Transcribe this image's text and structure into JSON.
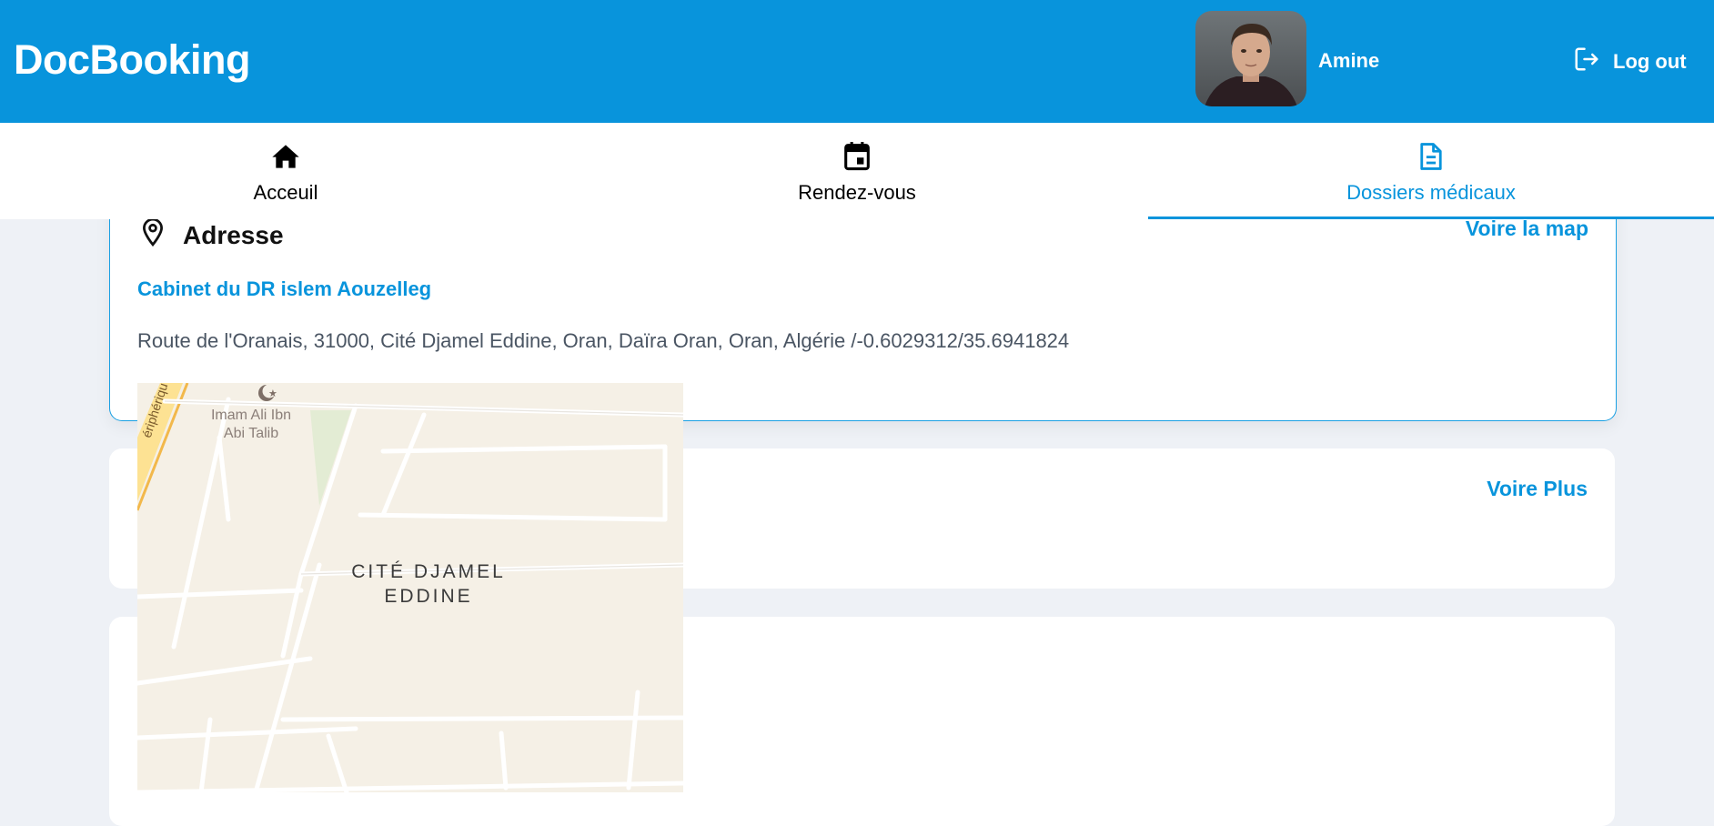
{
  "header": {
    "brand": "DocBooking",
    "user_name": "Amine",
    "logout_label": "Log out"
  },
  "nav": {
    "items": [
      {
        "label": "Acceuil",
        "icon": "home-icon"
      },
      {
        "label": "Rendez-vous",
        "icon": "calendar-icon"
      },
      {
        "label": "Dossiers médicaux",
        "icon": "document-icon",
        "active": true
      }
    ]
  },
  "address_card": {
    "title": "Adresse",
    "map_link": "Voire la map",
    "cabinet_name": "Cabinet du DR islem Aouzelleg",
    "address": "Route de l'Oranais, 31000, Cité Djamel Eddine, Oran, Daïra Oran, Oran, Algérie /-0.6029312/35.6941824"
  },
  "card2": {
    "more_link": "Voire Plus"
  },
  "map": {
    "district_line1": "CITÉ DJAMEL",
    "district_line2": "EDDINE",
    "poi_line1": "Imam Ali Ibn",
    "poi_line2": "Abi Talib",
    "road_label": "ériphériqu"
  },
  "colors": {
    "primary": "#0894dc",
    "page_bg": "#eef1f6",
    "map_bg": "#f5f0e6",
    "text_muted": "#4a5563"
  }
}
